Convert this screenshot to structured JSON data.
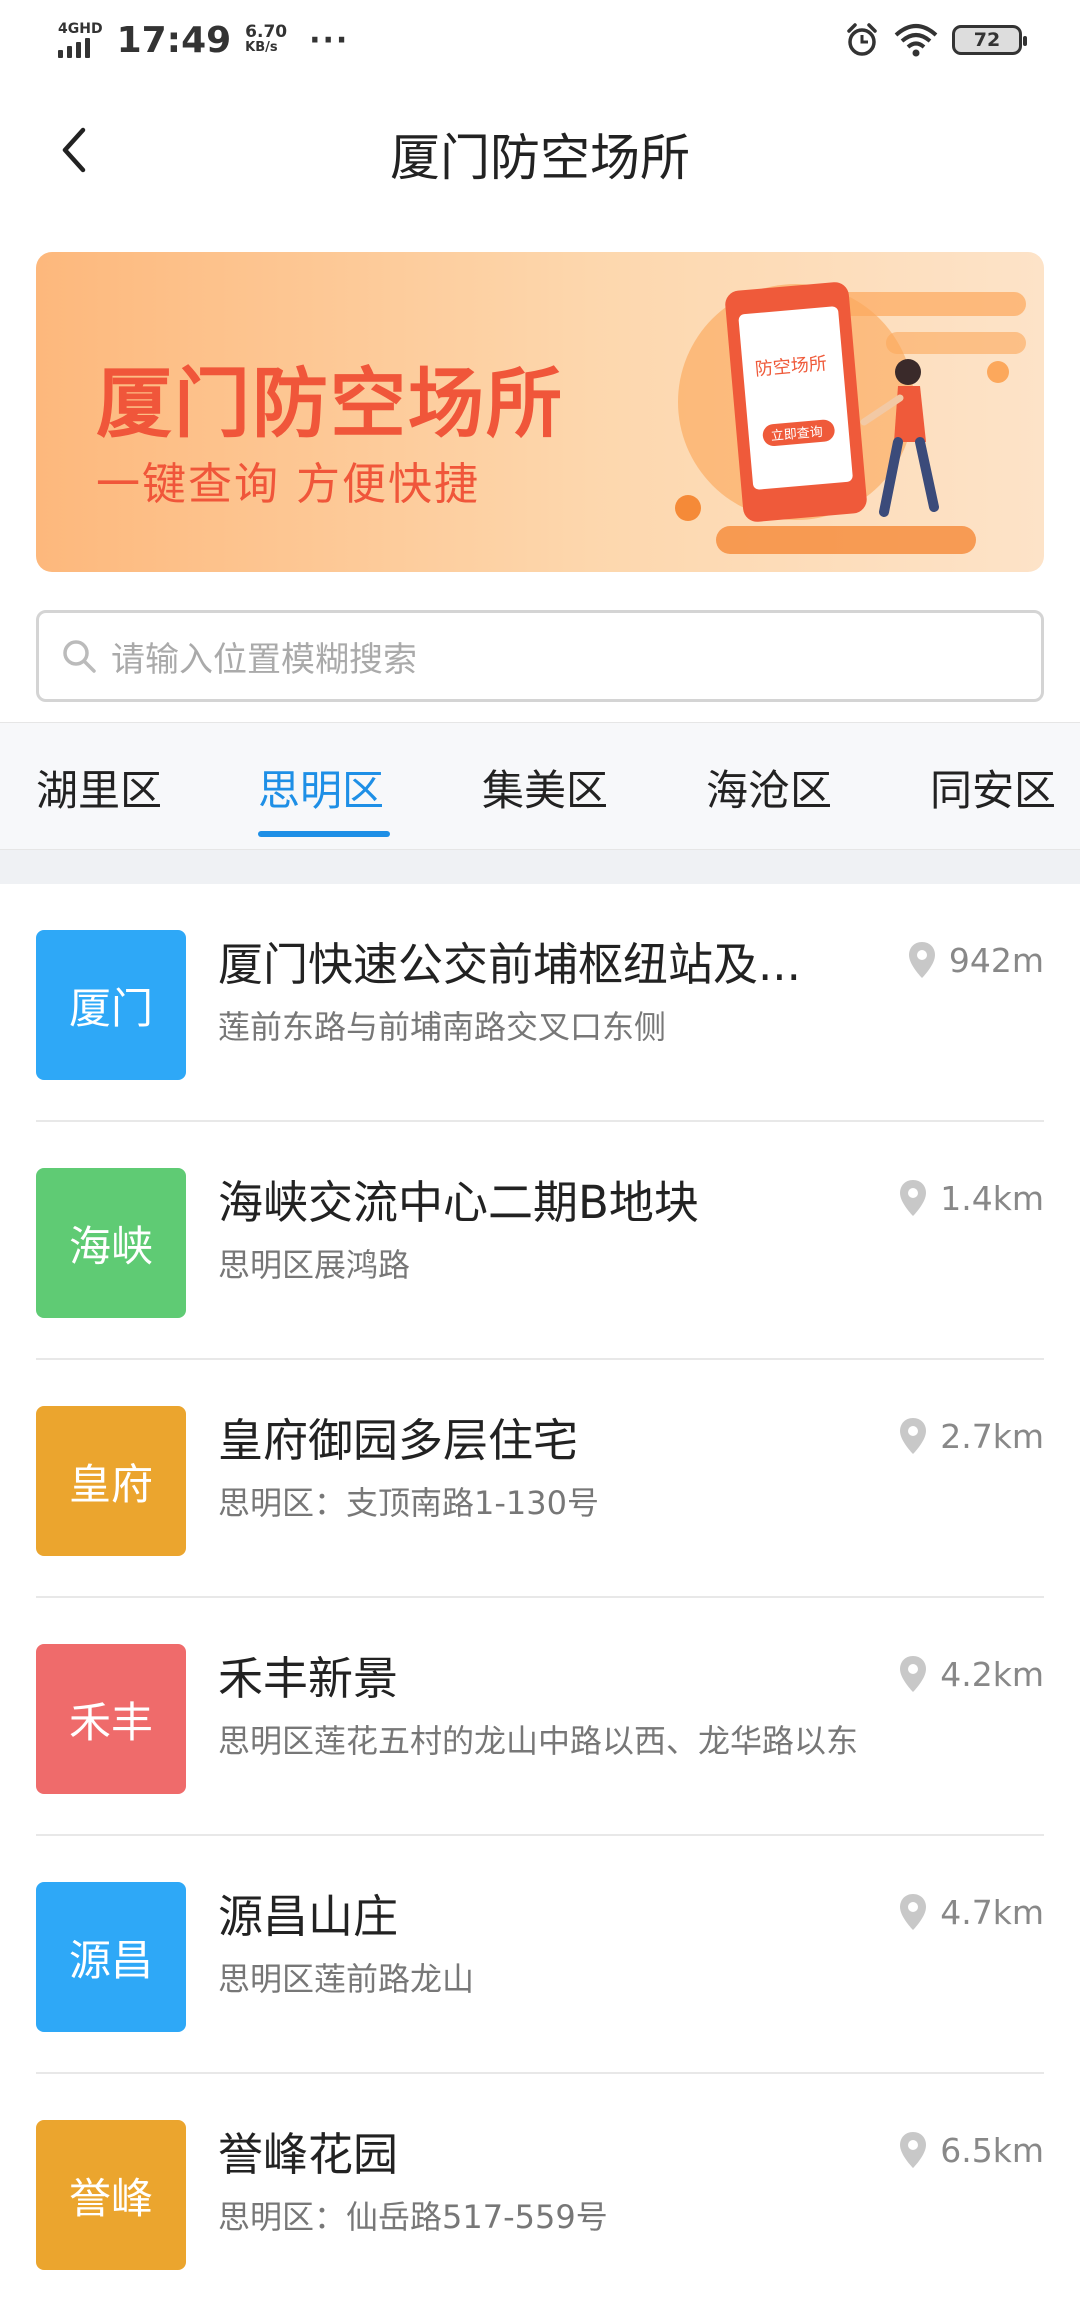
{
  "status": {
    "network": "4GHD",
    "time": "17:49",
    "speed_value": "6.70",
    "speed_unit": "KB/s",
    "more": "···",
    "battery": "72"
  },
  "header": {
    "title": "厦门防空场所"
  },
  "banner": {
    "title": "厦门防空场所",
    "subtitle": "一键查询   方便快捷",
    "phone_text": "防空场所",
    "phone_button": "立即查询"
  },
  "search": {
    "placeholder": "请输入位置模糊搜索"
  },
  "tabs": [
    {
      "label": "湖里区",
      "active": false
    },
    {
      "label": "思明区",
      "active": true
    },
    {
      "label": "集美区",
      "active": false
    },
    {
      "label": "海沧区",
      "active": false
    },
    {
      "label": "同安区",
      "active": false
    }
  ],
  "colors": {
    "accent": "#1e8fe6",
    "badge_blue": "#2ea8f7",
    "badge_green": "#5fcb74",
    "badge_orange": "#eba52e",
    "badge_red": "#ef6b6b",
    "banner_text": "#f0563a"
  },
  "items": [
    {
      "badge": "厦门",
      "badge_color": "#2ea8f7",
      "name": "厦门快速公交前埔枢纽站及...",
      "address": "莲前东路与前埔南路交叉口东侧",
      "distance": "942m"
    },
    {
      "badge": "海峡",
      "badge_color": "#5fcb74",
      "name": "海峡交流中心二期B地块",
      "address": "思明区展鸿路",
      "distance": "1.4km"
    },
    {
      "badge": "皇府",
      "badge_color": "#eba52e",
      "name": "皇府御园多层住宅",
      "address": "思明区：支顶南路1-130号",
      "distance": "2.7km"
    },
    {
      "badge": "禾丰",
      "badge_color": "#ef6b6b",
      "name": "禾丰新景",
      "address": "思明区莲花五村的龙山中路以西、龙华路以东",
      "distance": "4.2km"
    },
    {
      "badge": "源昌",
      "badge_color": "#2ea8f7",
      "name": "源昌山庄",
      "address": "思明区莲前路龙山",
      "distance": "4.7km"
    },
    {
      "badge": "誉峰",
      "badge_color": "#eba52e",
      "name": "誉峰花园",
      "address": "思明区：仙岳路517-559号",
      "distance": "6.5km"
    }
  ]
}
